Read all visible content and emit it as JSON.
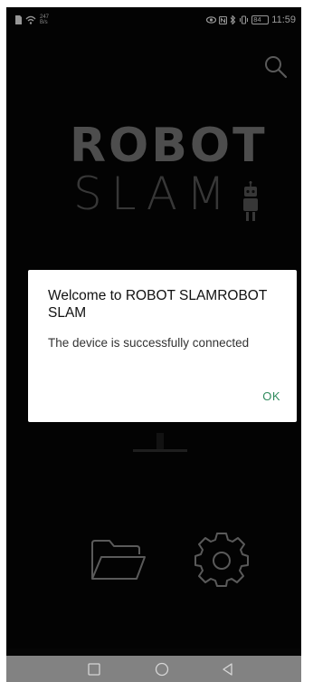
{
  "status_bar": {
    "network_speed_top": "247",
    "network_speed_bottom": "B/s",
    "battery_level": "84",
    "time": "11:59"
  },
  "logo": {
    "line1": "ROBOT",
    "line2": "SLAM"
  },
  "dialog": {
    "title": "Welcome to ROBOT SLAMROBOT SLAM",
    "message": "The device is successfully connected",
    "ok_label": "OK",
    "ok_color": "#2f8a5c"
  },
  "icons": {
    "search": "search-icon",
    "files": "folder-icon",
    "settings": "gear-icon"
  },
  "nav_bar": {
    "recent": "square-icon",
    "home": "circle-icon",
    "back": "triangle-back-icon",
    "color": "#828282"
  }
}
